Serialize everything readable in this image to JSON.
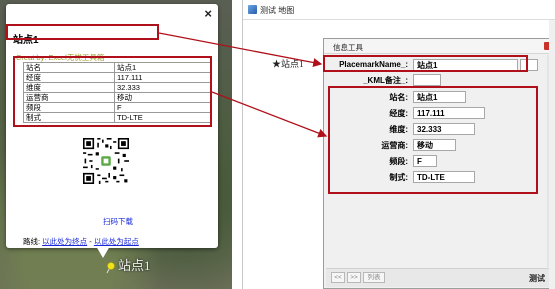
{
  "balloon": {
    "close_label": "×",
    "title": "站点1",
    "creat_by": "Creat by: Excel无忧工具箱",
    "table": [
      [
        "站名",
        "站点1"
      ],
      [
        "经度",
        "117.111"
      ],
      [
        "维度",
        "32.333"
      ],
      [
        "运营商",
        "移动"
      ],
      [
        "频段",
        "F"
      ],
      [
        "制式",
        "TD-LTE"
      ]
    ],
    "scan_label": "扫码下载",
    "route_prefix": "路线: ",
    "route_to": "以此处为终点",
    "route_sep": " - ",
    "route_from": "以此处为起点",
    "pin_label": "站点1"
  },
  "app": {
    "title": "测试 地图",
    "star_label": "★站点1"
  },
  "info_tool": {
    "title": "信息工具",
    "placemark_label": "PlacemarkName_:",
    "placemark_value": "站点1",
    "kml_label": "_KML备注_:",
    "kml_value": "",
    "fields": [
      {
        "label": "站名:",
        "value": "站点1"
      },
      {
        "label": "经度:",
        "value": "117.111"
      },
      {
        "label": "维度:",
        "value": "32.333"
      },
      {
        "label": "运营商:",
        "value": "移动"
      },
      {
        "label": "频段:",
        "value": "F"
      },
      {
        "label": "制式:",
        "value": "TD-LTE"
      }
    ],
    "nav_first": "<<",
    "nav_next": ">>",
    "nav_list": "列表",
    "footer_label": "测试"
  },
  "colors": {
    "highlight": "#b0101a",
    "link": "#1a2ad8"
  }
}
